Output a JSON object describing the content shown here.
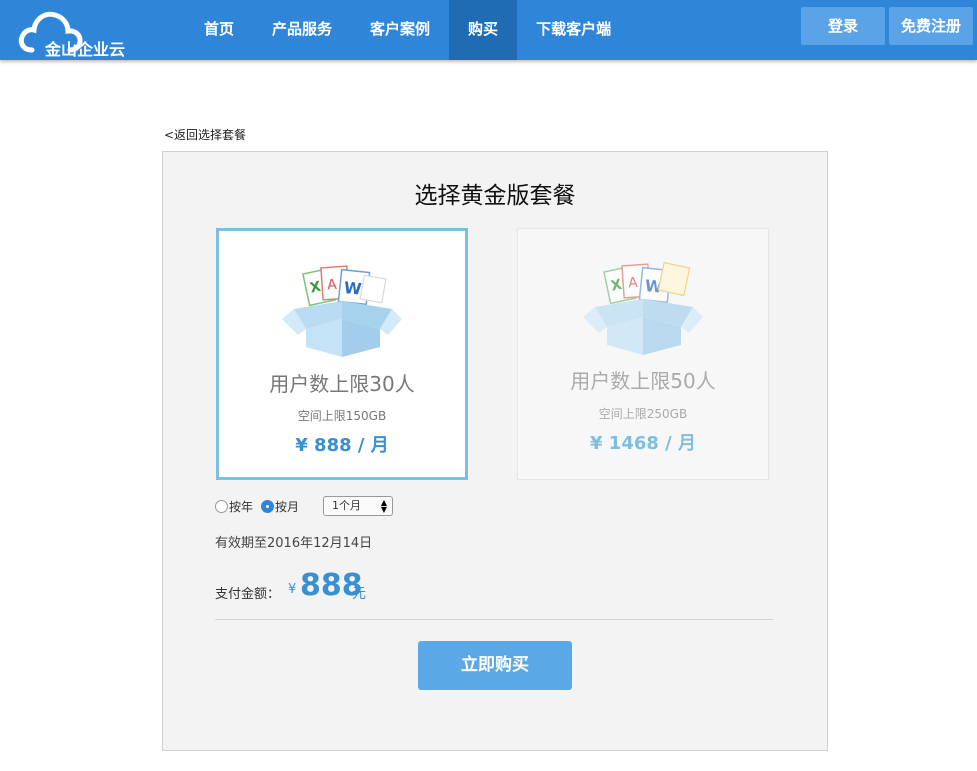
{
  "brand": {
    "name": "金山企业云",
    "color": "#2f86d8"
  },
  "nav": {
    "items": [
      {
        "label": "首页",
        "active": false
      },
      {
        "label": "产品服务",
        "active": false
      },
      {
        "label": "客户案例",
        "active": false
      },
      {
        "label": "购买",
        "active": true
      },
      {
        "label": "下载客户端",
        "active": false
      }
    ],
    "login": "登录",
    "register": "免费注册"
  },
  "back_link": "<返回选择套餐",
  "panel": {
    "title": "选择黄金版套餐",
    "plans": [
      {
        "users": "用户数上限30人",
        "space": "空间上限150GB",
        "price": "¥ 888 / 月",
        "selected": true,
        "icon": "files-box-icon"
      },
      {
        "users": "用户数上限50人",
        "space": "空间上限250GB",
        "price": "¥ 1468 / 月",
        "selected": false,
        "icon": "files-box-icon"
      }
    ],
    "billing": {
      "options": [
        {
          "label": "按年",
          "selected": false
        },
        {
          "label": "按月",
          "selected": true
        }
      ],
      "duration_value": "1个月"
    },
    "valid_until": "有效期至2016年12月14日",
    "payment": {
      "label": "支付金额：",
      "currency": "¥",
      "amount": "888",
      "unit": "元"
    },
    "buy_button": "立即购买"
  }
}
